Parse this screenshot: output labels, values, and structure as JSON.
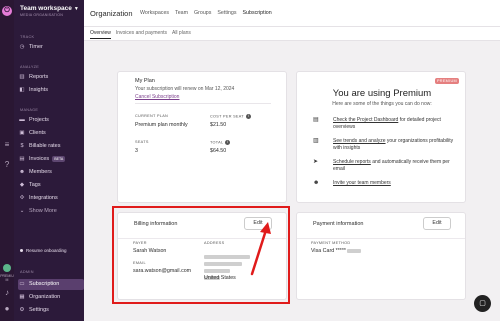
{
  "rail": {
    "logo_glyph": "⏻",
    "label_1": "PREMIU",
    "label_2": "M"
  },
  "sidebar": {
    "workspace_title": "Team workspace",
    "workspace_sub": "MEDIA ORGANISATION",
    "sections": {
      "track": "TRACK",
      "analyze": "ANALYZE",
      "manage": "MANAGE",
      "admin": "ADMIN"
    },
    "items": {
      "timer": "Timer",
      "reports": "Reports",
      "insights": "Insights",
      "projects": "Projects",
      "clients": "Clients",
      "billable_rates": "Billable rates",
      "invoices": "Invoices",
      "invoices_badge": "BETA",
      "members": "Members",
      "tags": "Tags",
      "integrations": "Integrations",
      "show_more": "Show More",
      "subscription": "Subscription",
      "organization": "Organization",
      "settings": "Settings"
    },
    "resume": "Resume onboarding"
  },
  "header": {
    "title": "Organization",
    "tabs": [
      "Workspaces",
      "Team",
      "Groups",
      "Settings",
      "Subscription"
    ],
    "subtabs": [
      "Overview",
      "Invoices and payments",
      "All plans"
    ]
  },
  "plan": {
    "title": "My Plan",
    "note": "Your subscription will renew on Mar 12, 2024",
    "cancel": "Cancel Subscription",
    "current_plan_label": "CURRENT PLAN",
    "current_plan_value": "Premium plan monthly",
    "cost_label": "COST PER SEAT",
    "cost_value": "$21.50",
    "seats_label": "SEATS",
    "seats_value": "3",
    "total_label": "TOTAL",
    "total_value": "$64.50"
  },
  "premium": {
    "badge": "PREMIUM",
    "title": "You are using Premium",
    "subtitle": "Here are some of the things you can do now:",
    "features": [
      {
        "icon": "clipboard-icon",
        "link": "Check the Project Dashboard",
        "rest": " for detailed project overviews"
      },
      {
        "icon": "chart-icon",
        "link": "See trends and analyze",
        "rest": " your organizations profitability with insights"
      },
      {
        "icon": "send-icon",
        "link": "Schedule reports",
        "rest": " and automatically receive them per email"
      },
      {
        "icon": "team-icon",
        "link": "Invite your team members",
        "rest": ""
      }
    ]
  },
  "billing": {
    "title": "Billing information",
    "edit": "Edit",
    "payer_label": "PAYER",
    "payer_value": "Sarah Watson",
    "email_label": "EMAIL",
    "email_value": "sara.watson@gmail.com",
    "address_label": "ADDRESS",
    "address_country": "United States"
  },
  "payment": {
    "title": "Payment information",
    "edit": "Edit",
    "method_label": "PAYMENT METHOD",
    "method_value": "Visa Card *****"
  },
  "colors": {
    "sidebar_bg": "#2c1a3a",
    "active_item": "#5a3f6e",
    "highlight": "#e01b1b",
    "premium_badge": "#e57f7f"
  }
}
